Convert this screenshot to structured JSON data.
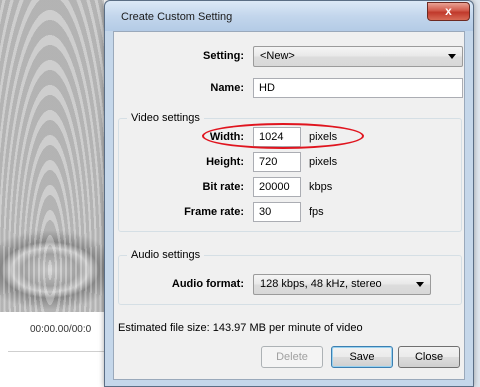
{
  "background": {
    "timecode": "00:00.00/00:0"
  },
  "dialog": {
    "title": "Create Custom Setting",
    "close_label": "x",
    "setting_label": "Setting:",
    "setting_value": "<New>",
    "name_label": "Name:",
    "name_value": "HD",
    "video_group_title": "Video settings",
    "width_label": "Width:",
    "width_value": "1024",
    "width_unit": "pixels",
    "height_label": "Height:",
    "height_value": "720",
    "height_unit": "pixels",
    "bitrate_label": "Bit rate:",
    "bitrate_value": "20000",
    "bitrate_unit": "kbps",
    "framerate_label": "Frame rate:",
    "framerate_value": "30",
    "framerate_unit": "fps",
    "audio_group_title": "Audio settings",
    "audio_format_label": "Audio format:",
    "audio_format_value": "128 kbps, 48 kHz, stereo",
    "estimate_text": "Estimated file size: 143.97 MB per minute of video",
    "delete_label": "Delete",
    "save_label": "Save",
    "close_button_label": "Close"
  },
  "colors": {
    "highlight": "#e0141e",
    "title_bar": "#c3d6ec"
  }
}
